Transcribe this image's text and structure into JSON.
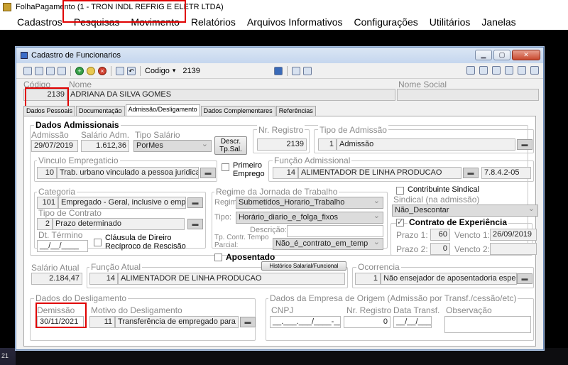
{
  "app": {
    "title": "FolhaPagamento (1 - TRON INDL REFRIG E ELETR LTDA)",
    "menu": [
      "Cadastros",
      "Pesquisas",
      "Movimento",
      "Relatórios",
      "Arquivos Informativos",
      "Configurações",
      "Utilitários",
      "Janelas"
    ]
  },
  "window": {
    "title": "Cadastro de Funcionarios",
    "toolbar": {
      "codigo_label": "Codigo",
      "codigo_value": "2139"
    }
  },
  "header": {
    "codigo_label": "Código",
    "codigo": "2139",
    "nome_label": "Nome",
    "nome": "ADRIANA DA SILVA GOMES",
    "nome_social_label": "Nome Social",
    "nome_social": ""
  },
  "tabs": [
    "Dados Pessoais",
    "Documentação",
    "Admissão/Desligamento",
    "Dados Complementares",
    "Referências"
  ],
  "admissao": {
    "section": "Dados Admissionais",
    "admissao_label": "Admissão",
    "admissao": "29/07/2019",
    "salario_label": "Salário Adm.",
    "salario": "1.612,36",
    "tipo_salario_label": "Tipo Salário",
    "tipo_salario": "PorMes",
    "descr_btn": "Descr. Tp.Sal.",
    "nr_registro_label": "Nr. Registro",
    "nr_registro": "2139",
    "tipo_adm_label": "Tipo de Admissão",
    "tipo_adm_code": "1",
    "tipo_adm": "Admissão"
  },
  "vinculo": {
    "label": "Vinculo Empregaticio",
    "code": "10",
    "text": "Trab. urbano vinculado a pessoa juridica,",
    "primeiro_emprego": "Primeiro Emprego",
    "funcao_label": "Função Admissional",
    "funcao_code": "14",
    "funcao": "ALIMENTADOR DE LINHA PRODUCAO",
    "cbo": "7.8.4.2-05"
  },
  "categoria": {
    "label": "Categoria",
    "code": "101",
    "text": "Empregado - Geral, inclusive o empre",
    "tipo_contrato_label": "Tipo de Contrato",
    "tipo_contrato_code": "2",
    "tipo_contrato": "Prazo determinado",
    "dt_termino_label": "Dt. Término",
    "dt_termino": "__/__/____",
    "clausula": "Cláusula de Direiro Recíproco de Rescisão"
  },
  "jornada": {
    "label": "Regime da Jornada de Trabalho",
    "regime_label": "Regime:",
    "regime": "Submetidos_Horario_Trabalho",
    "tipo_label": "Tipo:",
    "tipo": "Horário_diario_e_folga_fixos",
    "descricao_label": "Descrição:",
    "descricao": "",
    "tp_contr_label": "Tp. Contr. Tempo Parcial:",
    "tp_contr": "Não_é_contrato_em_temp",
    "aposentado": "Aposentado"
  },
  "sindical": {
    "contribuinte": "Contribuinte Sindical",
    "label": "Sindical (na admissão)",
    "value": "Não_Descontar",
    "experiencia": "Contrato de Experiência",
    "prazo1_label": "Prazo 1:",
    "prazo1": "60",
    "vencto1_label": "Vencto 1:",
    "vencto1": "26/09/2019",
    "prazo2_label": "Prazo 2:",
    "prazo2": "0",
    "vencto2_label": "Vencto 2:",
    "vencto2": ""
  },
  "atual": {
    "salario_label": "Salário Atual",
    "salario": "2.184,47",
    "funcao_label": "Função Atual",
    "funcao_code": "14",
    "funcao": "ALIMENTADOR DE LINHA PRODUCAO",
    "historico_btn": "Histórico Salarial/Funcional",
    "ocorrencia_label": "Ocorrencia",
    "ocorrencia_code": "1",
    "ocorrencia": "Não ensejador de aposentadoria especi"
  },
  "desligamento": {
    "section": "Dados do Desligamento",
    "demissao_label": "Demissão",
    "demissao": "30/11/2021",
    "motivo_label": "Motivo do Desligamento",
    "motivo_code": "11",
    "motivo": "Transferência de empregado para o"
  },
  "origem": {
    "section": "Dados da Empresa de Origem (Admissão por Transf./cessão/etc)",
    "cnpj_label": "CNPJ",
    "cnpj": "__.___.___/____-__",
    "nr_registro_label": "Nr. Registro",
    "nr_registro": "0",
    "data_label": "Data Transf.",
    "data": "__/__/____",
    "obs_label": "Observação",
    "obs": ""
  },
  "taskbar": {
    "clock": "21"
  }
}
